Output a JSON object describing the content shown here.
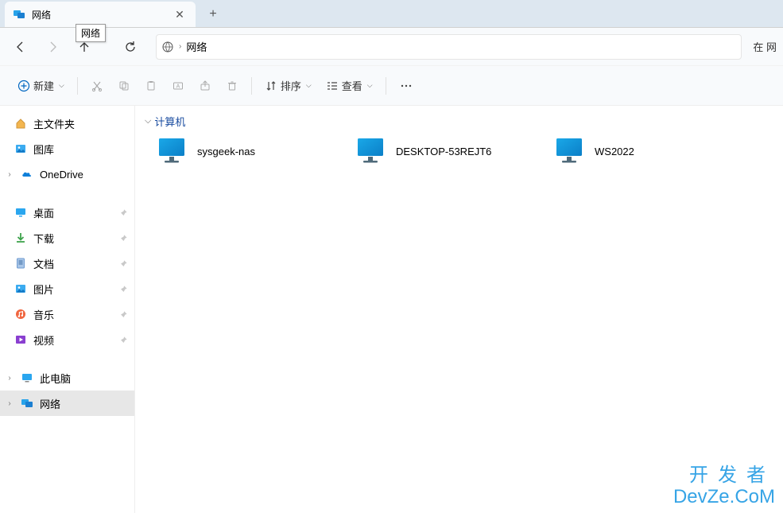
{
  "tab": {
    "title": "网络",
    "tooltip": "网络"
  },
  "address": {
    "current": "网络"
  },
  "search": {
    "hint": "在 网"
  },
  "toolbar": {
    "new_label": "新建",
    "sort_label": "排序",
    "view_label": "查看"
  },
  "sidebar": {
    "top": [
      {
        "label": "主文件夹",
        "icon": "home"
      },
      {
        "label": "图库",
        "icon": "gallery"
      },
      {
        "label": "OneDrive",
        "icon": "onedrive",
        "expandable": true
      }
    ],
    "pinned": [
      {
        "label": "桌面",
        "icon": "desktop"
      },
      {
        "label": "下载",
        "icon": "downloads"
      },
      {
        "label": "文档",
        "icon": "documents"
      },
      {
        "label": "图片",
        "icon": "pictures"
      },
      {
        "label": "音乐",
        "icon": "music"
      },
      {
        "label": "视频",
        "icon": "videos"
      }
    ],
    "bottom": [
      {
        "label": "此电脑",
        "icon": "thispc",
        "expandable": true
      },
      {
        "label": "网络",
        "icon": "network",
        "expandable": true,
        "selected": true
      }
    ]
  },
  "main": {
    "group_title": "计算机",
    "computers": [
      {
        "name": "sysgeek-nas"
      },
      {
        "name": "DESKTOP-53REJT6"
      },
      {
        "name": "WS2022"
      }
    ]
  },
  "watermark": {
    "line1": "开发者",
    "line2": "DevZe.CoM"
  }
}
